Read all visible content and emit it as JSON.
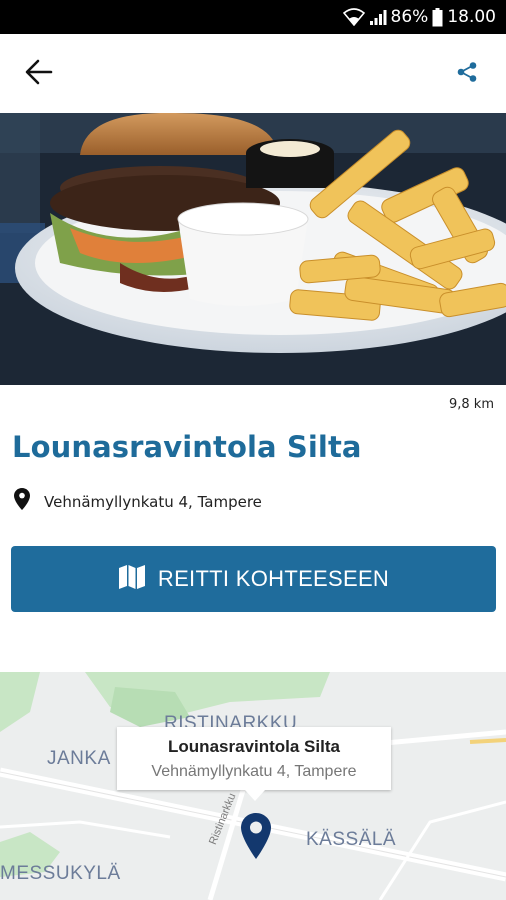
{
  "status_bar": {
    "battery": "86%",
    "time": "18.00",
    "icons": [
      "wifi-icon",
      "signal-icon",
      "battery-icon"
    ]
  },
  "app_bar": {
    "icons": [
      "back-arrow-icon",
      "share-icon"
    ]
  },
  "colors": {
    "accent": "#1f6c9c",
    "title": "#1e6b9a",
    "pin": "#13386e"
  },
  "hero": {
    "image": "burger-and-fries-photo"
  },
  "restaurant": {
    "distance": "9,8 km",
    "name": "Lounasravintola Silta",
    "address": "Vehnämyllynkatu 4, Tampere",
    "address_icon": "location-pin-icon"
  },
  "route_button": {
    "label": "REITTI KOHTEESEEN",
    "icon": "map-icon"
  },
  "map": {
    "areas": [
      "RISTINARKKU",
      "JANKA",
      "KÄSSÄLÄ",
      "MESSUKYLÄ"
    ],
    "road": "Ristinarkku",
    "callout_title": "Lounasravintola Silta",
    "callout_address": "Vehnämyllynkatu 4, Tampere",
    "marker_icon": "map-marker-icon"
  }
}
